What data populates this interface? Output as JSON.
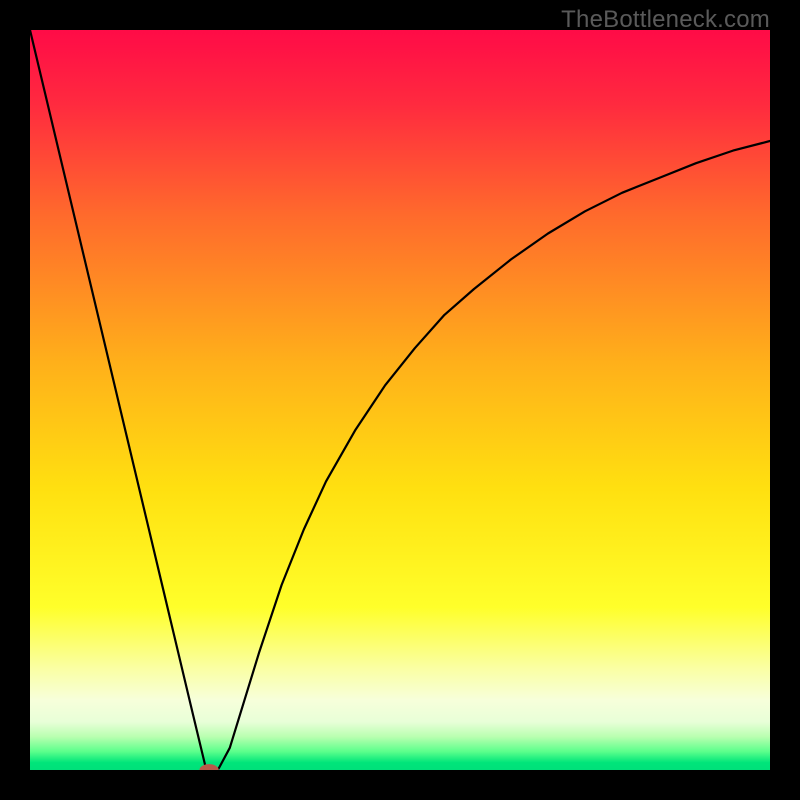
{
  "watermark": "TheBottleneck.com",
  "chart_data": {
    "type": "line",
    "title": "",
    "xlabel": "",
    "ylabel": "",
    "xlim": [
      0,
      100
    ],
    "ylim": [
      0,
      100
    ],
    "grid": false,
    "legend": false,
    "gradient_stops": [
      {
        "pct": 0.0,
        "color": "#ff0b47"
      },
      {
        "pct": 0.1,
        "color": "#ff2a3f"
      },
      {
        "pct": 0.25,
        "color": "#ff6a2c"
      },
      {
        "pct": 0.45,
        "color": "#ffb01a"
      },
      {
        "pct": 0.62,
        "color": "#ffe010"
      },
      {
        "pct": 0.78,
        "color": "#ffff2a"
      },
      {
        "pct": 0.86,
        "color": "#faffa0"
      },
      {
        "pct": 0.905,
        "color": "#f7ffda"
      },
      {
        "pct": 0.935,
        "color": "#e8ffd8"
      },
      {
        "pct": 0.955,
        "color": "#b9ffb0"
      },
      {
        "pct": 0.975,
        "color": "#5cff8c"
      },
      {
        "pct": 0.99,
        "color": "#00e57a"
      },
      {
        "pct": 1.0,
        "color": "#00e07a"
      }
    ],
    "series": [
      {
        "name": "curve",
        "color": "#000000",
        "x": [
          0,
          2,
          4,
          6,
          8,
          10,
          12,
          14,
          16,
          18,
          20,
          22,
          23.8,
          24.5,
          25.5,
          27,
          29,
          31,
          34,
          37,
          40,
          44,
          48,
          52,
          56,
          60,
          65,
          70,
          75,
          80,
          85,
          90,
          95,
          100
        ],
        "y": [
          100,
          91.6,
          83.2,
          74.8,
          66.4,
          58.0,
          49.6,
          41.2,
          32.8,
          24.4,
          16.0,
          7.6,
          0.1,
          0.0,
          0.2,
          3.0,
          9.5,
          16.0,
          25.0,
          32.5,
          39.0,
          46.0,
          52.0,
          57.0,
          61.5,
          65.0,
          69.0,
          72.5,
          75.5,
          78.0,
          80.0,
          82.0,
          83.7,
          85.0
        ]
      }
    ],
    "marker": {
      "name": "min-point",
      "x": 24.2,
      "y": 0.0,
      "rx": 1.3,
      "ry": 0.8,
      "fill": "#b85a4a"
    }
  }
}
